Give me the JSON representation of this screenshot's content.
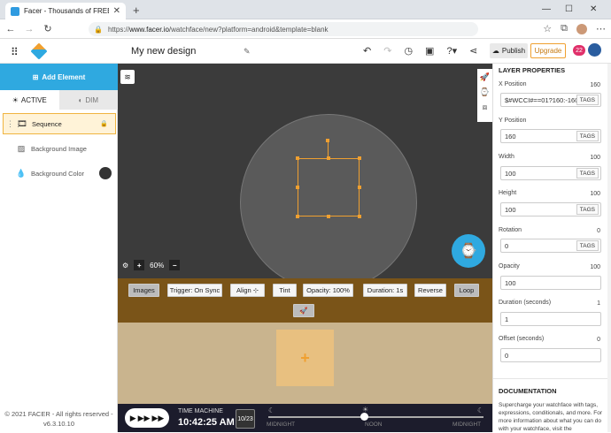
{
  "browser": {
    "tab_title": "Facer - Thousands of FREE watc",
    "url_prefix": "https://",
    "url_domain": "www.facer.io",
    "url_path": "/watchface/new?platform=android&template=blank"
  },
  "header": {
    "design_name": "My new design",
    "publish_label": "Publish",
    "upgrade_label": "Upgrade",
    "notif_count": "22"
  },
  "left": {
    "add_element": "Add Element",
    "tab_active": "ACTIVE",
    "tab_dim": "DIM",
    "layers": [
      "Sequence",
      "Background Image",
      "Background Color"
    ],
    "footer_line1": "© 2021 FACER - All rights reserved -",
    "footer_line2": "v6.3.10.10"
  },
  "canvas": {
    "zoom_level": "60%"
  },
  "animation": {
    "images": "Images",
    "trigger": "Trigger: On Sync",
    "align": "Align",
    "tint": "Tint",
    "opacity": "Opacity: 100%",
    "duration": "Duration: 1s",
    "reverse": "Reverse",
    "loop": "Loop"
  },
  "timemachine": {
    "label": "TIME MACHINE",
    "time": "10:42:25 AM",
    "date": "10/23",
    "ticks": [
      "MIDNIGHT",
      "NOON",
      "MIDNIGHT"
    ]
  },
  "properties": {
    "title": "LAYER PROPERTIES",
    "tags_label": "TAGS",
    "x_label": "X Position",
    "x_value": "160",
    "x_input": "$#WCCI#==01?160:-160",
    "y_label": "Y Position",
    "y_value": "160",
    "y_input": "160",
    "w_label": "Width",
    "w_value": "100",
    "w_input": "100",
    "h_label": "Height",
    "h_value": "100",
    "h_input": "100",
    "r_label": "Rotation",
    "r_value": "0",
    "r_input": "0",
    "o_label": "Opacity",
    "o_value": "100",
    "o_input": "100",
    "d_label": "Duration (seconds)",
    "d_value": "1",
    "d_input": "1",
    "off_label": "Offset (seconds)",
    "off_value": "0",
    "off_input": "0",
    "doc_title": "DOCUMENTATION",
    "doc_text": "Supercharge your watchface with tags, expressions, conditionals, and more. For more information about what you can do with your watchface, visit the"
  }
}
